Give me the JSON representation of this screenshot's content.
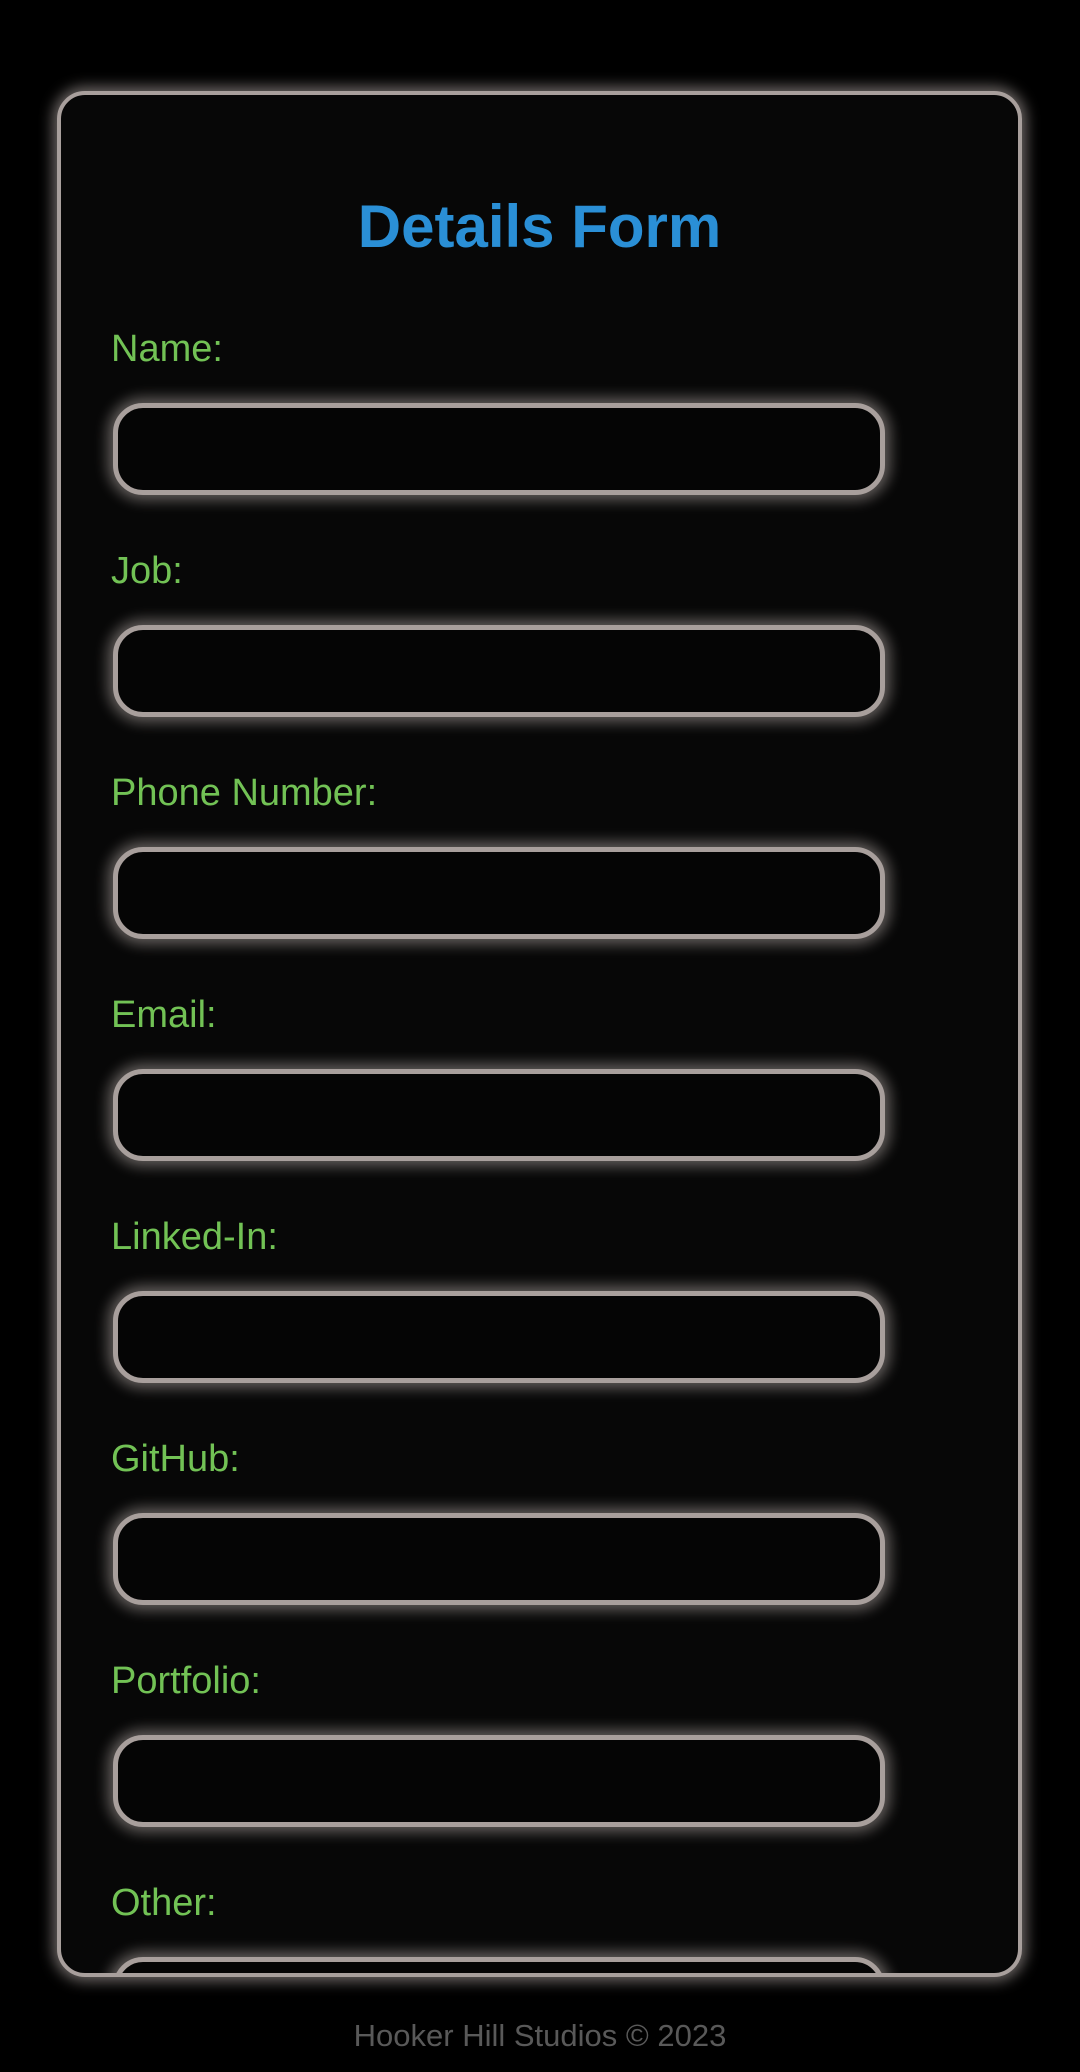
{
  "form": {
    "title": "Details Form",
    "fields": [
      {
        "label": "Name:",
        "value": "",
        "placeholder": ""
      },
      {
        "label": "Job:",
        "value": "",
        "placeholder": ""
      },
      {
        "label": "Phone Number:",
        "value": "",
        "placeholder": ""
      },
      {
        "label": "Email:",
        "value": "",
        "placeholder": ""
      },
      {
        "label": "Linked-In:",
        "value": "",
        "placeholder": ""
      },
      {
        "label": "GitHub:",
        "value": "",
        "placeholder": ""
      },
      {
        "label": "Portfolio:",
        "value": "",
        "placeholder": ""
      },
      {
        "label": "Other:",
        "value": "",
        "placeholder": ""
      }
    ]
  },
  "footer": {
    "text": "Hooker Hill Studios © 2023"
  },
  "colors": {
    "background": "#000000",
    "card_background": "#070707",
    "glow_border": "#a89f9c",
    "title": "#2a8fd6",
    "label": "#72c255",
    "footer_text": "#595959"
  }
}
